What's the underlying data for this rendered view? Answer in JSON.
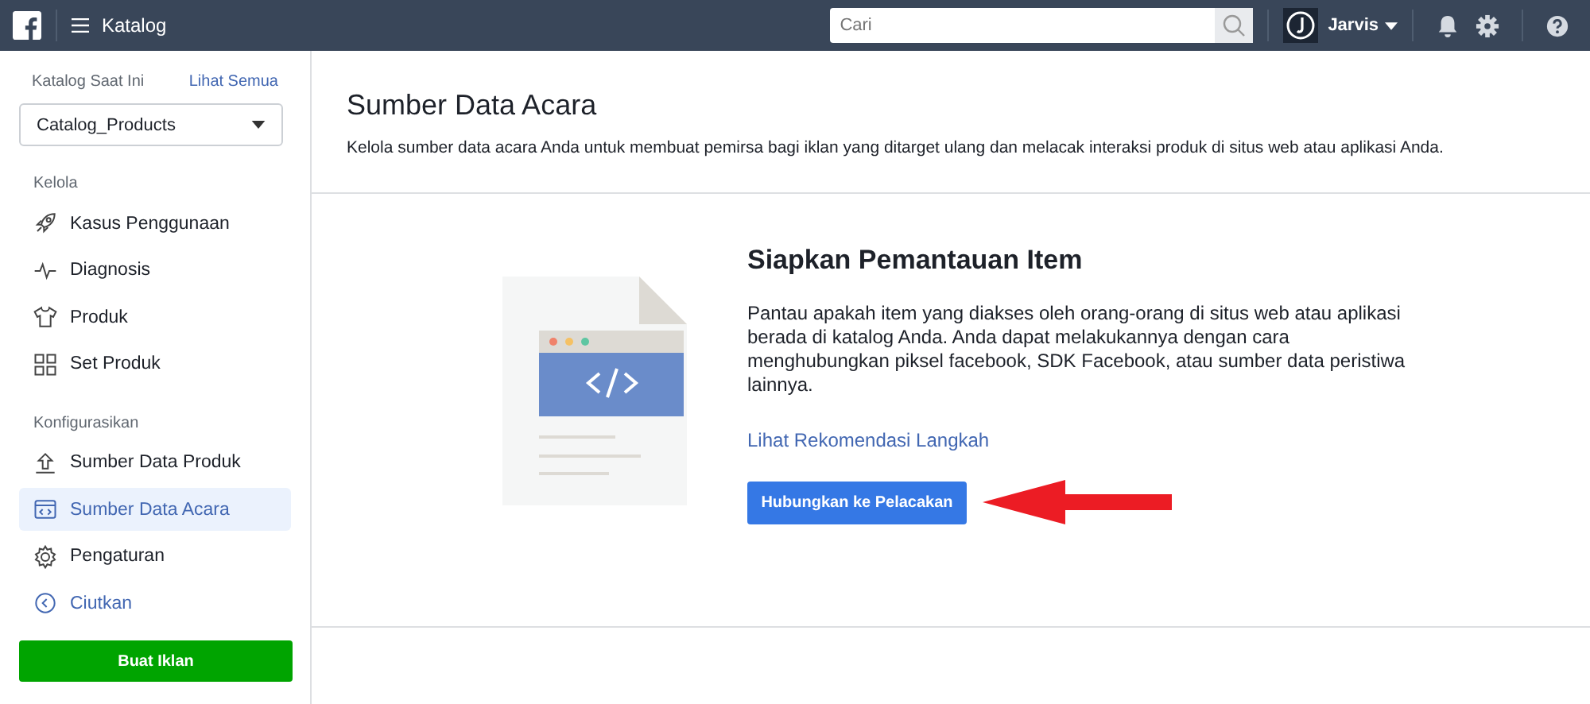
{
  "topbar": {
    "title": "Katalog",
    "search": {
      "placeholder": "Cari"
    },
    "user": "Jarvis"
  },
  "sidebar": {
    "catalog_label": "Katalog Saat Ini",
    "see_all": "Lihat Semua",
    "catalog_select": "Catalog_Products",
    "sections": [
      {
        "heading": "Kelola",
        "items": [
          {
            "label": "Kasus Penggunaan",
            "kind": "rocket",
            "selected": false
          },
          {
            "label": "Diagnosis",
            "kind": "pulse",
            "selected": false
          },
          {
            "label": "Produk",
            "kind": "shirt",
            "selected": false
          },
          {
            "label": "Set Produk",
            "kind": "grid",
            "selected": false
          }
        ]
      },
      {
        "heading": "Konfigurasikan",
        "items": [
          {
            "label": "Sumber Data Produk",
            "kind": "upload",
            "selected": false
          },
          {
            "label": "Sumber Data Acara",
            "kind": "code",
            "selected": true
          },
          {
            "label": "Pengaturan",
            "kind": "gear",
            "selected": false
          }
        ]
      }
    ],
    "collapse": "Ciutkan",
    "create_button": "Buat Iklan"
  },
  "main": {
    "title": "Sumber Data Acara",
    "description": "Kelola sumber data acara Anda untuk membuat pemirsa bagi iklan yang ditarget ulang dan melacak interaksi produk di situs web atau aplikasi Anda.",
    "card": {
      "heading": "Siapkan Pemantauan Item",
      "body": "Pantau apakah item yang diakses oleh orang-orang di situs web atau aplikasi berada di katalog Anda. Anda dapat melakukannya dengan cara menghubungkan piksel facebook, SDK Facebook, atau sumber data peristiwa lainnya.",
      "link": "Lihat Rekomendasi Langkah",
      "button": "Hubungkan ke Pelacakan"
    }
  }
}
